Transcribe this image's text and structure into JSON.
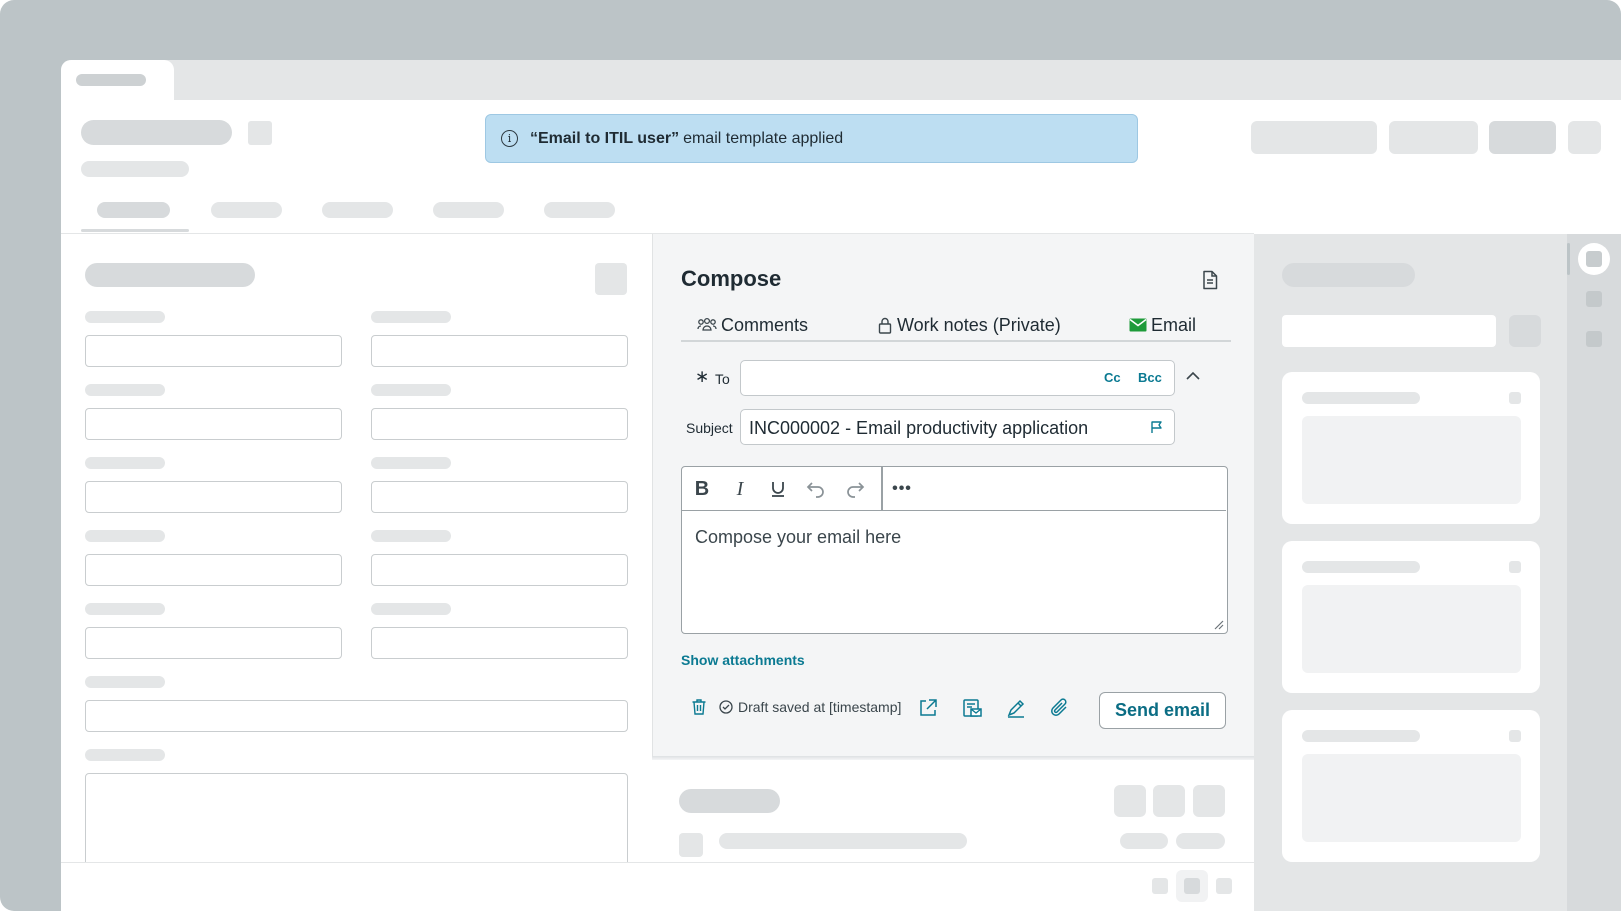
{
  "toast": {
    "icon": "info-icon",
    "template_name": "“Email to ITIL user”",
    "message": "email template applied"
  },
  "compose": {
    "title": "Compose",
    "tabs": [
      {
        "label": "Comments",
        "icon": "people-icon"
      },
      {
        "label": "Work notes (Private)",
        "icon": "lock-icon"
      },
      {
        "label": "Email",
        "icon": "envelope-icon",
        "active": true
      }
    ],
    "to_required_mark": "∗",
    "to_label": "To",
    "to_value": "",
    "cc_label": "Cc",
    "bcc_label": "Bcc",
    "subject_label": "Subject",
    "subject_value": "INC000002 - Email productivity application",
    "editor_placeholder": "Compose your email here",
    "show_attachments": "Show attachments",
    "draft_status": "Draft saved at [timestamp]",
    "send_label": "Send email"
  },
  "colors": {
    "accent": "#0b7a92",
    "toast_bg": "#bddef2",
    "email_icon": "#1e9b3a",
    "frame": "#bcc4c7"
  }
}
